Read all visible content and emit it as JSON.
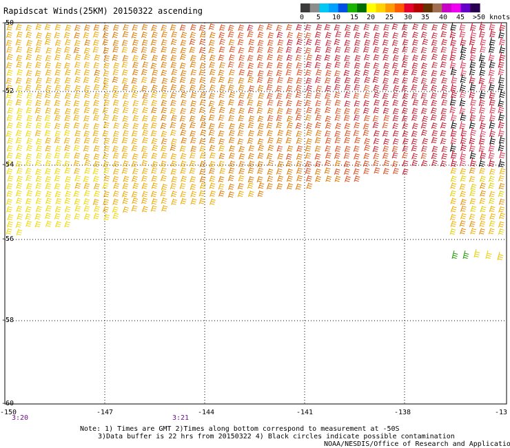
{
  "title": "Rapidscat Winds(25KM) 20150322 ascending",
  "legend": {
    "colors": [
      "#3b3b3b",
      "#8c8c8c",
      "#00c8f5",
      "#00a0ff",
      "#0050e6",
      "#19b400",
      "#006e00",
      "#ffff00",
      "#ffd200",
      "#ff9b00",
      "#ff5a00",
      "#e6002d",
      "#b40000",
      "#643200",
      "#a06e50",
      "#c800c8",
      "#f000f0",
      "#6400c8",
      "#280050"
    ],
    "labels": [
      "0",
      "5",
      "10",
      "15",
      "20",
      "25",
      "30",
      "35",
      "40",
      "45",
      ">50 knots"
    ]
  },
  "map": {
    "lon_labels": [
      "-150",
      "-147",
      "-144",
      "-141",
      "-138",
      "-13"
    ],
    "lat_labels": [
      "-50",
      "-52",
      "-54",
      "-56",
      "-58",
      "-60"
    ]
  },
  "times": [
    "3:20",
    "3:21"
  ],
  "notes": [
    "Note: 1) Times are GMT 2)Times along bottom correspond to measurement at -50S",
    "3)Data buffer is 22 hrs from 20150322 4) Black circles indicate possible contamination",
    "NOAA/NESDIS/Office of Research and Applications"
  ]
}
